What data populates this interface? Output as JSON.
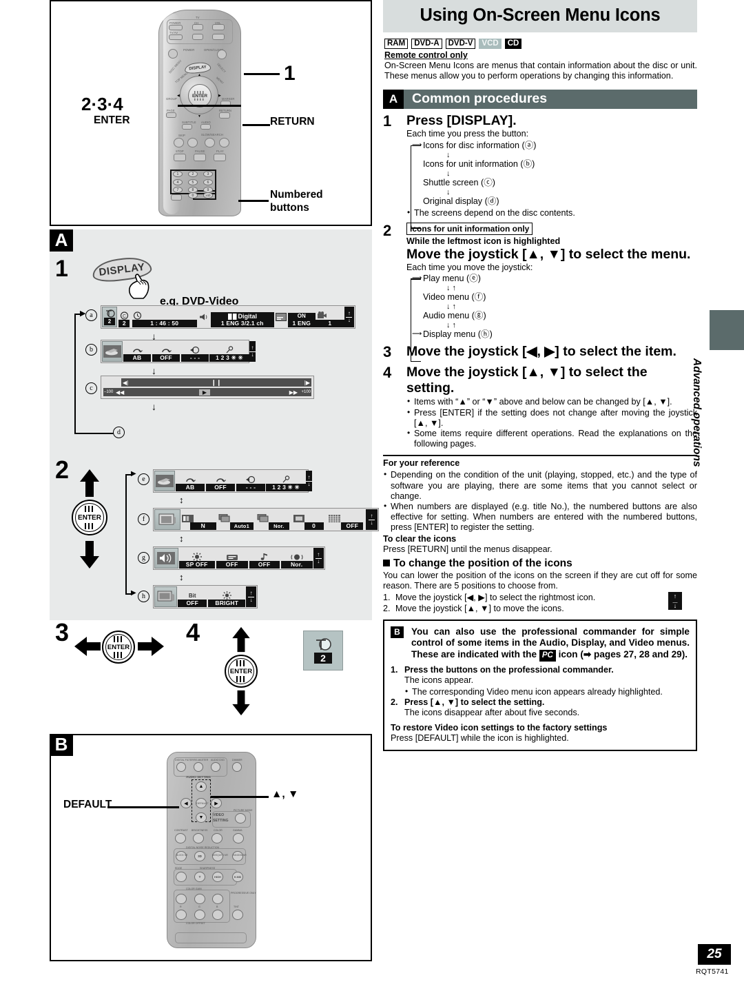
{
  "header": {
    "title": "Using On-Screen Menu Icons",
    "disc_badges": [
      "RAM",
      "DVD-A",
      "DVD-V",
      "VCD",
      "CD"
    ],
    "remote_note": "Remote control only",
    "intro": "On-Screen Menu Icons are menus that contain information about the disc or unit. These menus allow you to perform operations by changing this information."
  },
  "section_a": {
    "letter": "A",
    "heading": "Common procedures",
    "step1": {
      "num": "1",
      "title": "Press [DISPLAY].",
      "lead": "Each time you press the button:",
      "flow": [
        "Icons for disc information (ⓐ)",
        "Icons for unit information (ⓑ)",
        "Shuttle screen (ⓒ)",
        "Original display (ⓓ)"
      ],
      "note": "The screens depend on the disc contents."
    },
    "step2": {
      "num": "2",
      "boxlabel": "Icons for unit information only",
      "condition": "While the leftmost icon is highlighted",
      "title": "Move the joystick [▲, ▼] to select the menu.",
      "lead": "Each time you move the joystick:",
      "flow": [
        "Play menu (ⓔ)",
        "Video menu (ⓕ)",
        "Audio menu (ⓖ)",
        "Display menu (ⓗ)"
      ]
    },
    "step3": {
      "num": "3",
      "title": "Move the joystick [◀, ▶] to select the item."
    },
    "step4": {
      "num": "4",
      "title": "Move the joystick [▲, ▼] to select the setting.",
      "bullets": [
        "Items with “▲” or “▼” above and below can be changed by [▲, ▼].",
        "Press [ENTER] if the setting does not change after moving the joystick [▲, ▼].",
        "Some items require different operations. Read the explanations on the following pages."
      ]
    }
  },
  "reference": {
    "heading": "For your reference",
    "bullets": [
      "Depending on the condition of the unit (playing, stopped, etc.) and the type of software you are playing, there are some items that you cannot select or change.",
      "When numbers are displayed (e.g. title No.), the numbered buttons are also effective for setting. When numbers are entered with the numbered buttons, press [ENTER] to register the setting."
    ],
    "clear_head": "To clear the icons",
    "clear_body": "Press [RETURN] until the menus disappear.",
    "position_head": "To change the position of the icons",
    "position_body": "You can lower the position of the icons on the screen if they are cut off for some reason. There are 5 positions to choose from.",
    "position_steps": [
      {
        "ix": "1.",
        "text": "Move the joystick [◀, ▶] to select the rightmost icon."
      },
      {
        "ix": "2.",
        "text": "Move the joystick [▲, ▼] to move the icons."
      }
    ]
  },
  "section_b": {
    "letter": "B",
    "intro_pre": "You can also use the professional commander for simple control of some items in the Audio, Display, and Video menus. These are indicated with the",
    "chip": "PC",
    "intro_post": "icon (➡ pages 27, 28 and 29).",
    "steps": [
      {
        "ix": "1.",
        "bold": "Press the buttons on the professional commander.",
        "sub": "The icons appear.",
        "bullet": "The corresponding Video menu icon appears already highlighted."
      },
      {
        "ix": "2.",
        "bold": "Press [▲, ▼] to select the setting.",
        "sub": "The icons disappear after about five seconds."
      }
    ],
    "restore_head": "To restore Video icon settings to the factory settings",
    "restore_body": "Press [DEFAULT] while the icon is highlighted."
  },
  "left_figures": {
    "remote_callouts": {
      "one": "1",
      "enter_steps": "2·3·4",
      "enter_label": "ENTER",
      "return_label": "RETURN",
      "numbered_label_line1": "Numbered",
      "numbered_label_line2": "buttons"
    },
    "remote_keys": {
      "tv": "TV",
      "power": "POWER",
      "ch": "CH",
      "vol": "VOL",
      "tvav": "TV/AV",
      "power2": "POWER",
      "openclose": "OPEN/CLOSE",
      "display": "DISPLAY",
      "discmenu": "DISC MENU",
      "topmenu": "TOP MENU",
      "select": "SELECT",
      "menu": "MENU",
      "group": "GROUP",
      "marker": "MARKER",
      "page": "PAGE",
      "return": "RETURN",
      "subtitle": "SUBTITLE",
      "audio": "AUDIO",
      "skip": "SKIP",
      "slowsearch": "SLOW/SEARCH",
      "stop": "STOP",
      "pause": "PAUSE",
      "play": "PLAY",
      "enter": "ENTER",
      "numbers": [
        "1",
        "2",
        "3",
        "4",
        "5",
        "6",
        "7",
        "8",
        "9",
        "0",
        ">10"
      ]
    },
    "stepA": {
      "num": "1",
      "button": "DISPLAY",
      "example_caption": "e.g. DVD-Video",
      "rows": [
        {
          "key": "a",
          "cells": [
            {
              "icon": "title-icon",
              "value": "2",
              "highlight": true
            },
            {
              "icon": "chapter-icon",
              "value": "2"
            },
            {
              "icon": "clock-icon",
              "value": "1 : 46 : 50"
            },
            {
              "icon": "speaker-icon",
              "value": ""
            },
            {
              "icon": "dolby-digital-icon",
              "value": "1 ENG  3/2.1 ch",
              "toplabel": "Digital"
            },
            {
              "icon": "subtitle-icon",
              "value": ""
            },
            {
              "icon": "subtitle-on-icon",
              "value": "1 ENG",
              "toplabel": "ON"
            },
            {
              "icon": "angle-camera-icon",
              "value": "1"
            },
            {
              "icon": "position-icon",
              "value": ""
            }
          ]
        },
        {
          "key": "b",
          "cells": [
            {
              "icon": "play-menu-icon",
              "value": "",
              "highlight": true
            },
            {
              "icon": "ab-repeat-icon",
              "value": "AB"
            },
            {
              "icon": "repeat-icon",
              "value": "OFF"
            },
            {
              "icon": "marker-icon",
              "value": "- - -"
            },
            {
              "icon": "pin-icon",
              "value": "1 2 3 ✳ ✳"
            },
            {
              "icon": "position-icon",
              "value": ""
            }
          ]
        },
        {
          "key": "c",
          "type": "shuttle",
          "left_label": "–100",
          "right_label": "+100"
        },
        {
          "key": "d",
          "type": "original-display"
        }
      ]
    },
    "step2_rows": [
      {
        "key": "e",
        "cells": [
          {
            "icon": "play-menu-icon",
            "value": "",
            "highlight": true
          },
          {
            "icon": "ab-repeat-icon",
            "value": "AB"
          },
          {
            "icon": "repeat-icon",
            "value": "OFF"
          },
          {
            "icon": "marker-icon",
            "value": "- - -"
          },
          {
            "icon": "pin-icon",
            "value": "1 2 3 ✳ ✳"
          },
          {
            "icon": "position-icon",
            "value": ""
          }
        ]
      },
      {
        "key": "f",
        "cells": [
          {
            "icon": "video-menu-icon",
            "value": "",
            "highlight": true
          },
          {
            "icon": "picture-mode-icon",
            "value": "N"
          },
          {
            "icon": "progressive-icon",
            "value": "Auto1"
          },
          {
            "icon": "transfer-mode-icon",
            "value": "Nor."
          },
          {
            "icon": "picture-adjust-icon",
            "value": "0"
          },
          {
            "icon": "grid-icon",
            "value": "OFF"
          },
          {
            "icon": "position-icon",
            "value": ""
          }
        ]
      },
      {
        "key": "g",
        "cells": [
          {
            "icon": "audio-menu-icon",
            "value": "",
            "highlight": true
          },
          {
            "icon": "virtual-surround-icon",
            "value": "SP OFF"
          },
          {
            "icon": "dialogue-icon",
            "value": "OFF"
          },
          {
            "icon": "music-icon",
            "value": "OFF"
          },
          {
            "icon": "sound-field-icon",
            "value": "Nor."
          },
          {
            "icon": "position-icon",
            "value": ""
          }
        ]
      },
      {
        "key": "h",
        "cells": [
          {
            "icon": "display-menu-icon",
            "value": "",
            "highlight": true
          },
          {
            "icon": "bitrate-icon",
            "value": "OFF",
            "toplabel": "Bit"
          },
          {
            "icon": "brightness-icon",
            "value": "BRIGHT"
          },
          {
            "icon": "position-icon",
            "value": ""
          }
        ]
      }
    ],
    "step3": {
      "num": "3",
      "enter": "ENTER"
    },
    "step4": {
      "num": "4",
      "enter": "ENTER",
      "chip_value": "2"
    },
    "sectionB_fig": {
      "letter": "B",
      "default_label": "DEFAULT",
      "updown_label": "▲, ▼",
      "commander_keys": {
        "digital_filter": "DIGITAL FILTER",
        "re_master": "RE-MASTER",
        "audio_dvd": "AUDIO DVD",
        "dimmer": "DIMMER",
        "audio_setting": "AUDIO SETTING",
        "default": "DEFAULT",
        "video_setting_1": "VIDEO",
        "video_setting_2": "SETTING",
        "picture_mode": "PICTURE MODE",
        "contrast": "CONTRAST",
        "brightness": "BRIGHTNESS",
        "color": "COLOR",
        "gamma": "GAMMA",
        "dnr": "DIGITAL NOISE REDUCTION",
        "block_nr": "BLOCK NR",
        "3d": "3D",
        "mosquito_nr": "MOSQUITO NR",
        "random_nr": "RANDOM NR",
        "edge": "EDGE",
        "sharpness": "SHARPNESS",
        "sharp_y": "Y",
        "sharp_high": "HIGH",
        "sharp_hmid": "H-MID",
        "color_gain": "COLOR GAIN",
        "progressive_only": "PROGRESSIVE ONLY",
        "r": "R",
        "g": "G",
        "b": "B",
        "tint": "TINT",
        "color_offset": "COLOR OFFSET"
      }
    }
  },
  "sidebar": {
    "tab_text": "Advanced operations"
  },
  "footer": {
    "page": "25",
    "code": "RQT5741"
  }
}
